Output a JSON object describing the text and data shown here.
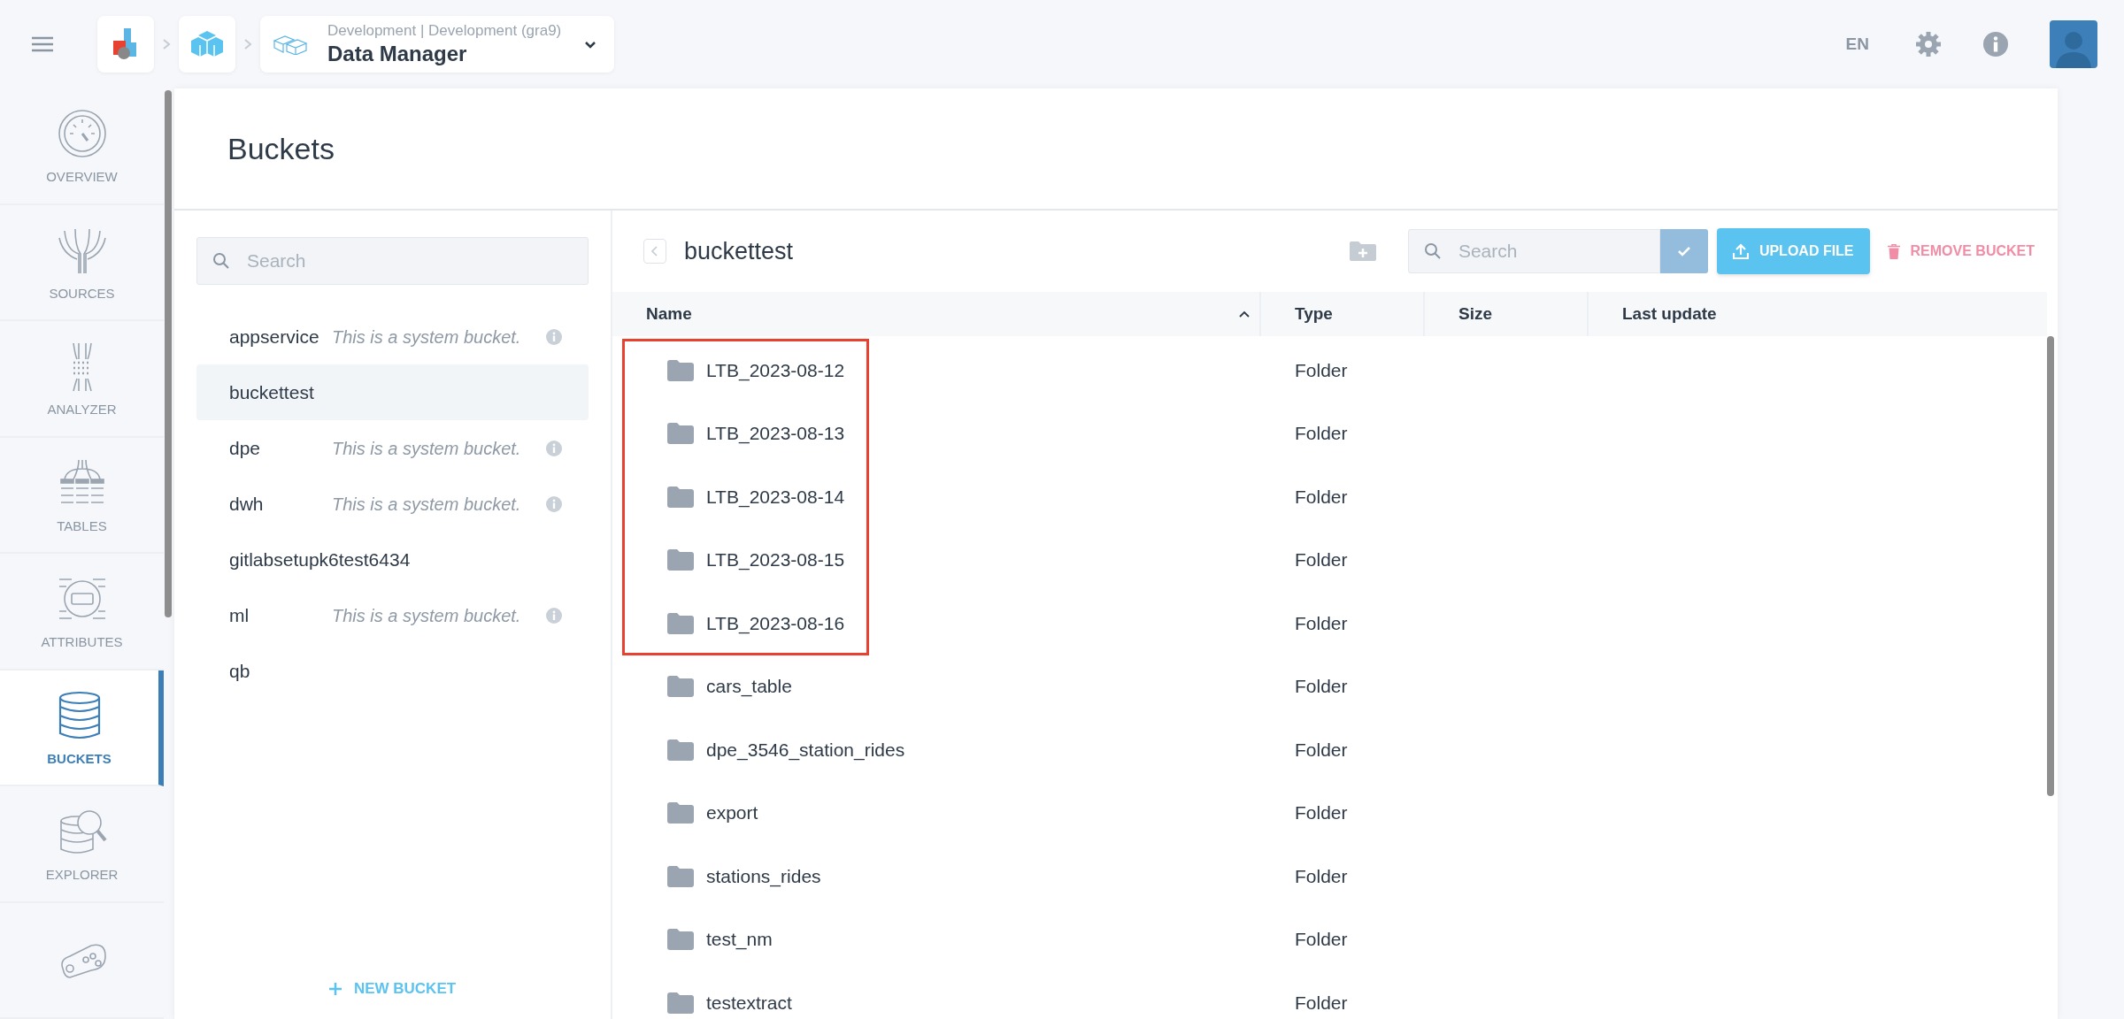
{
  "top_bar": {
    "breadcrumb": {
      "subtitle": "Development | Development (gra9)",
      "title": "Data Manager"
    },
    "language": "EN"
  },
  "nav": [
    {
      "kind": "overview",
      "label": "OVERVIEW",
      "selected": false
    },
    {
      "kind": "sources",
      "label": "SOURCES",
      "selected": false
    },
    {
      "kind": "analyzer",
      "label": "ANALYZER",
      "selected": false
    },
    {
      "kind": "tables",
      "label": "TABLES",
      "selected": false
    },
    {
      "kind": "attributes",
      "label": "ATTRIBUTES",
      "selected": false
    },
    {
      "kind": "buckets",
      "label": "BUCKETS",
      "selected": true
    },
    {
      "kind": "explorer",
      "label": "EXPLORER",
      "selected": false
    },
    {
      "kind": "pipeline",
      "selected": false
    }
  ],
  "page": {
    "title": "Buckets"
  },
  "buckets_pane": {
    "search": {
      "placeholder": "Search"
    },
    "items": [
      {
        "name": "appservice",
        "note": "This is a system bucket.",
        "selected": false
      },
      {
        "name": "buckettest",
        "selected": true
      },
      {
        "name": "dpe",
        "note": "This is a system bucket.",
        "selected": false
      },
      {
        "name": "dwh",
        "note": "This is a system bucket.",
        "selected": false
      },
      {
        "name": "gitlabsetupk6test6434",
        "selected": false
      },
      {
        "name": "ml",
        "note": "This is a system bucket.",
        "selected": false
      },
      {
        "name": "qb",
        "selected": false
      }
    ],
    "new_bucket": "NEW BUCKET"
  },
  "browser": {
    "path": "buckettest",
    "search": {
      "placeholder": "Search"
    },
    "upload": "UPLOAD FILE",
    "remove": "REMOVE BUCKET",
    "columns": [
      {
        "label": "Name",
        "sorted": true
      },
      {
        "label": "Type",
        "sorted": false
      },
      {
        "label": "Size",
        "sorted": false
      },
      {
        "label": "Last update",
        "sorted": false
      }
    ],
    "rows": [
      {
        "name": "LTB_2023-08-12",
        "type": "Folder",
        "highlighted": true
      },
      {
        "name": "LTB_2023-08-13",
        "type": "Folder",
        "highlighted": true
      },
      {
        "name": "LTB_2023-08-14",
        "type": "Folder",
        "highlighted": true
      },
      {
        "name": "LTB_2023-08-15",
        "type": "Folder",
        "highlighted": true
      },
      {
        "name": "LTB_2023-08-16",
        "type": "Folder",
        "highlighted": true
      },
      {
        "name": "cars_table",
        "type": "Folder",
        "highlighted": false
      },
      {
        "name": "dpe_3546_station_rides",
        "type": "Folder",
        "highlighted": false
      },
      {
        "name": "export",
        "type": "Folder",
        "highlighted": false
      },
      {
        "name": "stations_rides",
        "type": "Folder",
        "highlighted": false
      },
      {
        "name": "test_nm",
        "type": "Folder",
        "highlighted": false
      },
      {
        "name": "testextract",
        "type": "Folder",
        "highlighted": false
      }
    ]
  }
}
